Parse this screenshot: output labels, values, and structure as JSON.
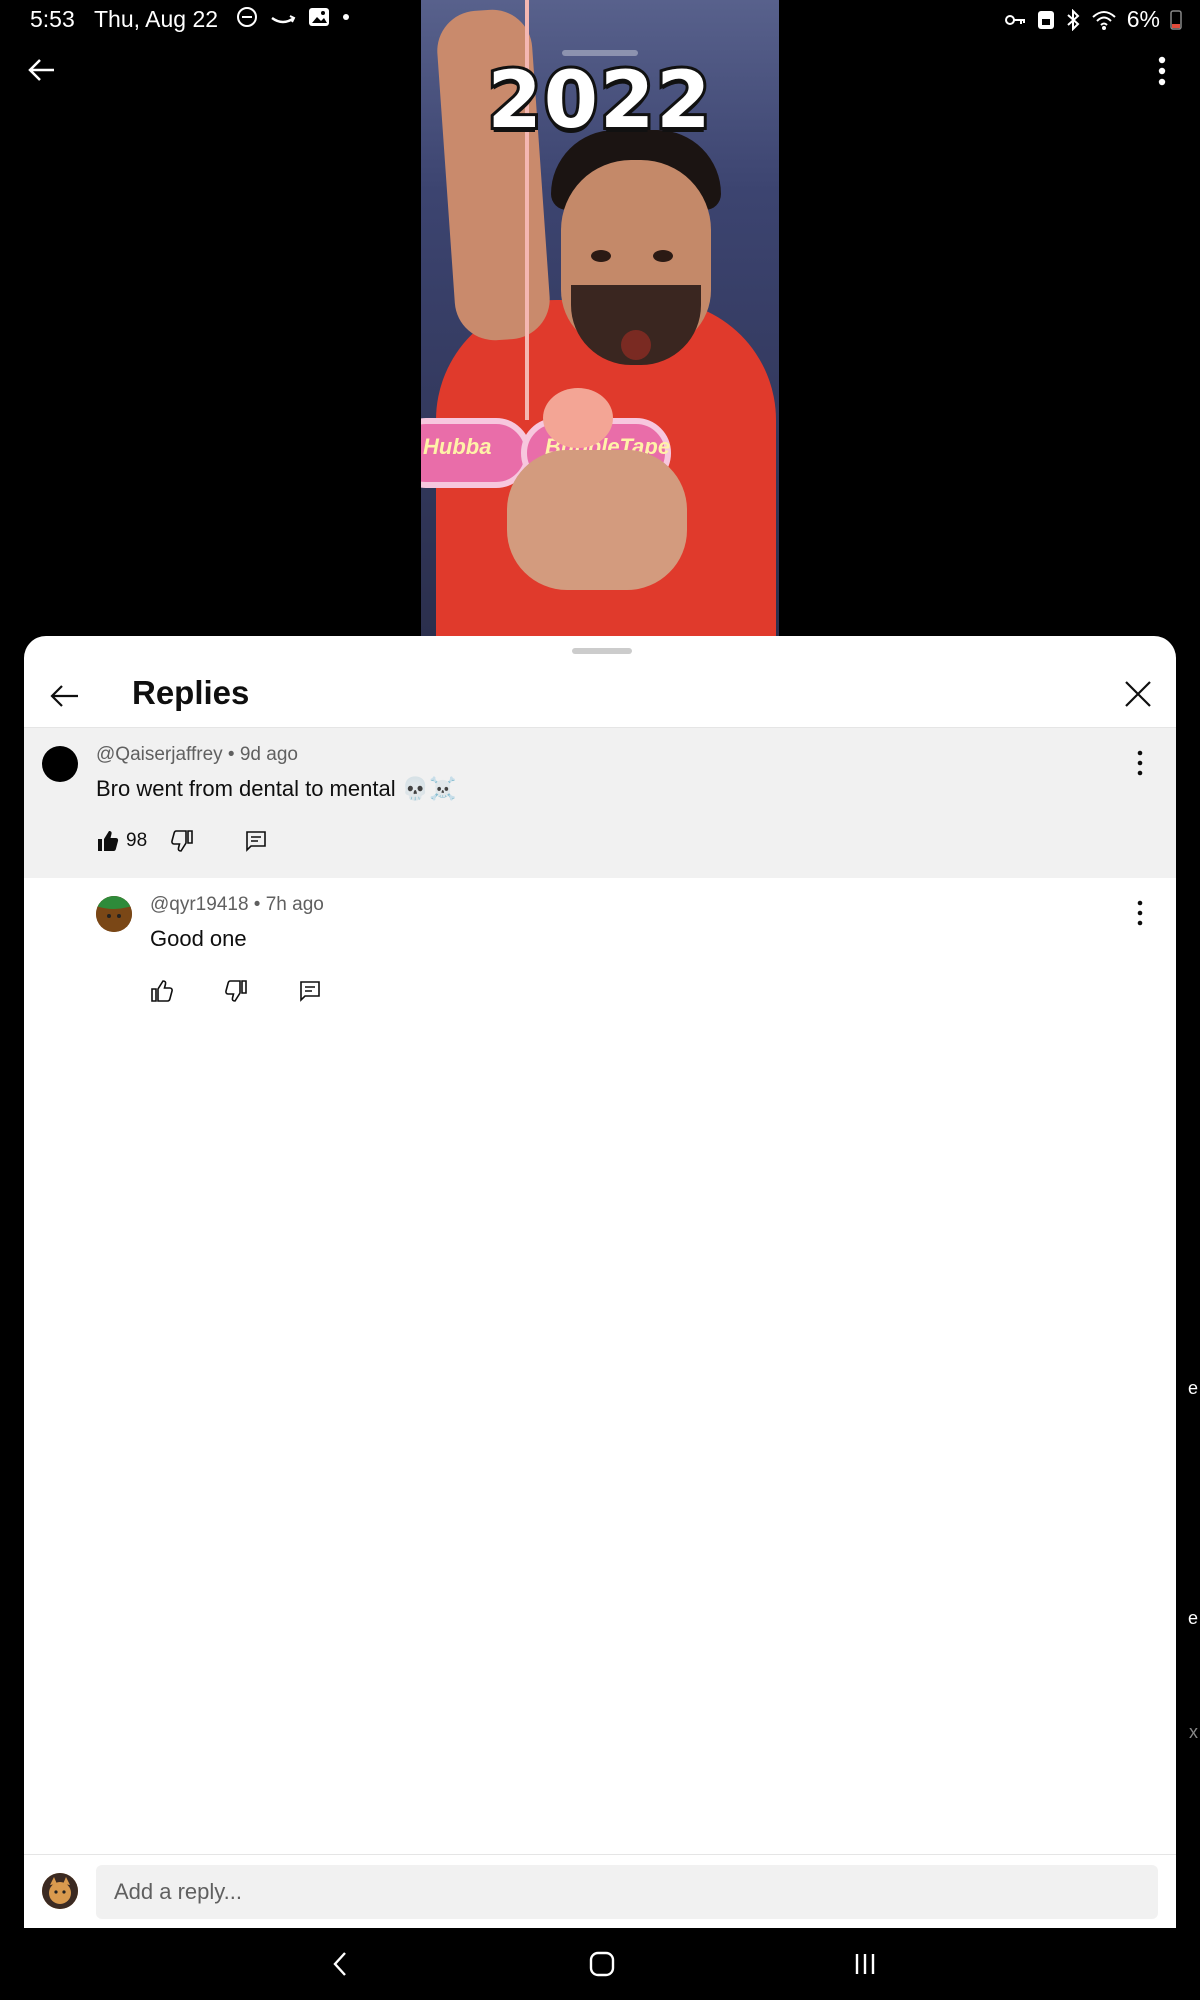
{
  "status_bar": {
    "time": "5:53",
    "date": "Thu, Aug 22",
    "battery": "6%"
  },
  "video": {
    "overlay_text": "2022",
    "product_label": "BubbleTape",
    "product_label_2": "Hubba"
  },
  "replies_panel": {
    "title": "Replies",
    "parent_comment": {
      "author": "@Qaiserjaffrey",
      "age": "9d ago",
      "meta": "@Qaiserjaffrey • 9d ago",
      "text": "Bro went from dental to mental 💀☠️",
      "like_count": "98"
    },
    "reply": {
      "author": "@qyr19418",
      "age": "7h ago",
      "meta": "@qyr19418 • 7h ago",
      "text": "Good one",
      "like_count": ""
    },
    "reply_input": {
      "placeholder": "Add a reply..."
    }
  },
  "right_edge": [
    "e",
    "e",
    "x"
  ],
  "colors": {
    "sheet_background": "#ffffff",
    "highlight_background": "#f1f1f1",
    "meta_text": "#606060",
    "primary_text": "#0f0f0f",
    "system_bar": "#000000",
    "battery_low": "#e24b3b"
  }
}
